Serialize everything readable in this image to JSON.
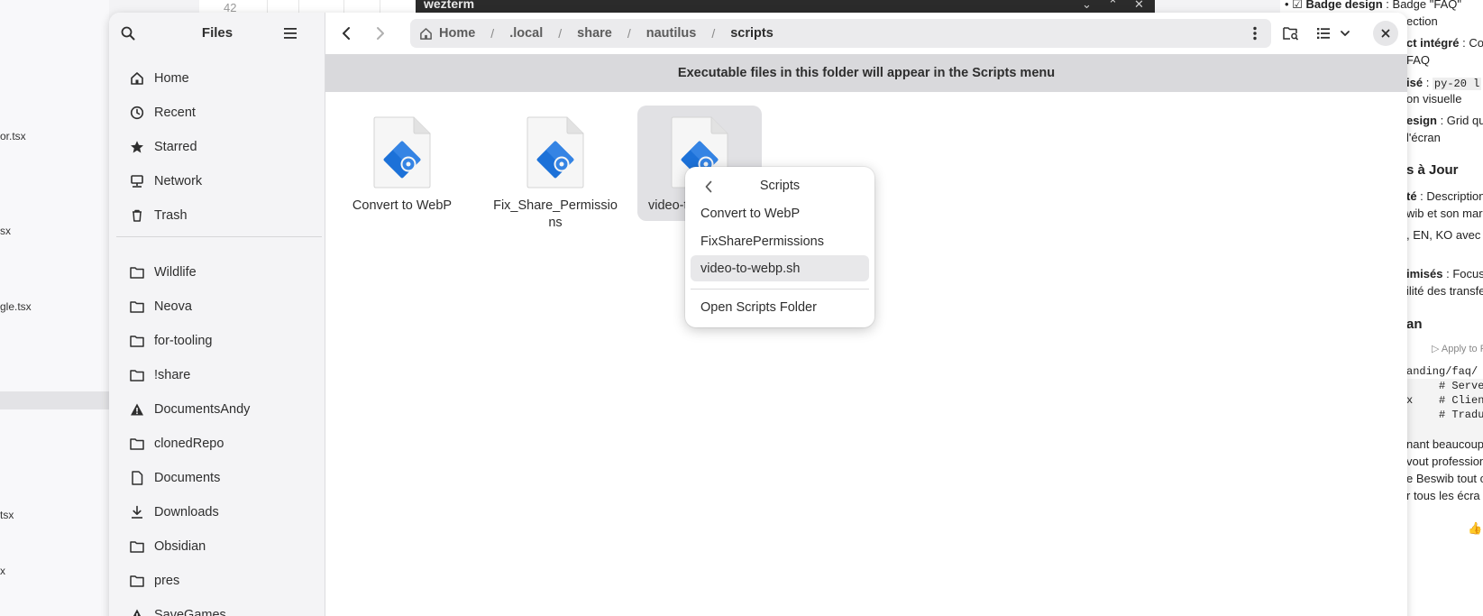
{
  "background": {
    "left_files": [
      "or.tsx",
      "sx",
      "gle.tsx",
      "tsx",
      "x"
    ],
    "grid_number": "42",
    "terminal_title": "wezterm",
    "right_panel": {
      "lines": [
        {
          "bold": "☑ Badge design",
          "text": " : Badge \"FAQ\""
        },
        {
          "bold": "",
          "text": "ection"
        },
        {
          "bold": "ct intégré",
          "text": " : Co"
        },
        {
          "bold": "",
          "text": "FAQ"
        },
        {
          "bold": "isé",
          "text": " : "
        },
        {
          "bold": "",
          "text": "on visuelle"
        },
        {
          "bold": "esign",
          "text": " : Grid qui"
        },
        {
          "bold": "",
          "text": "l'écran"
        },
        {
          "bold": "s à Jour",
          "text": ""
        },
        {
          "bold": "té",
          "text": " : Description"
        },
        {
          "bold": "",
          "text": "wib et son mar"
        },
        {
          "bold": "",
          "text": ", EN, KO avec c"
        },
        {
          "bold": "imisés",
          "text": " : Focus"
        },
        {
          "bold": "",
          "text": "ilité des transfe"
        },
        {
          "bold": "an",
          "text": ""
        },
        {
          "bold": "",
          "text": "nant beaucoup"
        },
        {
          "bold": "",
          "text": "vout profession"
        },
        {
          "bold": "",
          "text": "e Beswib tout c"
        },
        {
          "bold": "",
          "text": "r tous les écra"
        }
      ],
      "inline_code": "py-20 l",
      "apply_label": "▷ Apply to F",
      "code_lines": [
        "anding/faq/",
        "     # Serve",
        "x    # Clien",
        "     # Tradu"
      ]
    }
  },
  "sidebar": {
    "title": "Files",
    "places": [
      {
        "label": "Home",
        "icon": "home-icon"
      },
      {
        "label": "Recent",
        "icon": "clock-icon"
      },
      {
        "label": "Starred",
        "icon": "star-icon"
      },
      {
        "label": "Network",
        "icon": "network-icon"
      },
      {
        "label": "Trash",
        "icon": "trash-icon"
      }
    ],
    "bookmarks": [
      {
        "label": "Wildlife",
        "icon": "folder-icon"
      },
      {
        "label": "Neova",
        "icon": "folder-icon"
      },
      {
        "label": "for-tooling",
        "icon": "folder-icon"
      },
      {
        "label": "!share",
        "icon": "folder-icon"
      },
      {
        "label": "DocumentsAndy",
        "icon": "warning-icon"
      },
      {
        "label": "clonedRepo",
        "icon": "folder-icon"
      },
      {
        "label": "Documents",
        "icon": "document-icon"
      },
      {
        "label": "Downloads",
        "icon": "download-icon"
      },
      {
        "label": "Obsidian",
        "icon": "folder-icon"
      },
      {
        "label": "pres",
        "icon": "folder-icon"
      },
      {
        "label": "SaveGames",
        "icon": "warning-icon"
      }
    ]
  },
  "pathbar": {
    "crumbs": [
      "Home",
      ".local",
      "share",
      "nautilus",
      "scripts"
    ]
  },
  "banner": "Executable files in this folder will appear in the Scripts menu",
  "files": [
    {
      "name": "Convert to WebP",
      "selected": false
    },
    {
      "name": "Fix_Share_Permissions",
      "selected": false
    },
    {
      "name": "video-to-webp.sh",
      "visible_name": "video-to-",
      "selected": true
    }
  ],
  "popover": {
    "title": "Scripts",
    "items": [
      "Convert to WebP",
      "FixSharePermissions",
      "video-to-webp.sh"
    ],
    "hovered_index": 2,
    "footer_item": "Open Scripts Folder"
  },
  "colors": {
    "accent_blue": "#3584e4",
    "script_icon_blue": "#1c71d8",
    "selection_bg": "#e1e1e4"
  }
}
